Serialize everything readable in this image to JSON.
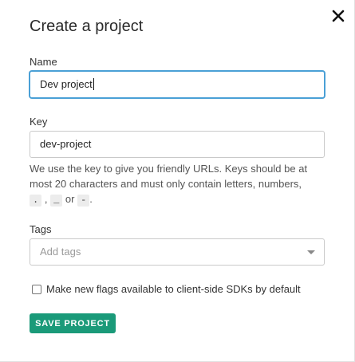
{
  "dialog": {
    "title": "Create a project"
  },
  "name_field": {
    "label": "Name",
    "value": "Dev project"
  },
  "key_field": {
    "label": "Key",
    "value": "dev-project",
    "help_text": "We use the key to give you friendly URLs. Keys should be at most 20 characters and must only contain letters, numbers,",
    "allowed_chars": [
      ".",
      "_",
      "-"
    ],
    "or_text": "or",
    "comma": ",",
    "period": "."
  },
  "tags_field": {
    "label": "Tags",
    "placeholder": "Add tags"
  },
  "client_side_option": {
    "label": "Make new flags available to client-side SDKs by default",
    "checked": false
  },
  "actions": {
    "save_label": "SAVE PROJECT"
  },
  "icons": {
    "close": "close-icon",
    "tags_dropdown": "chevron-down-icon"
  },
  "colors": {
    "primary_button": "#1a9a79",
    "focus_border": "#4aa0d6"
  }
}
